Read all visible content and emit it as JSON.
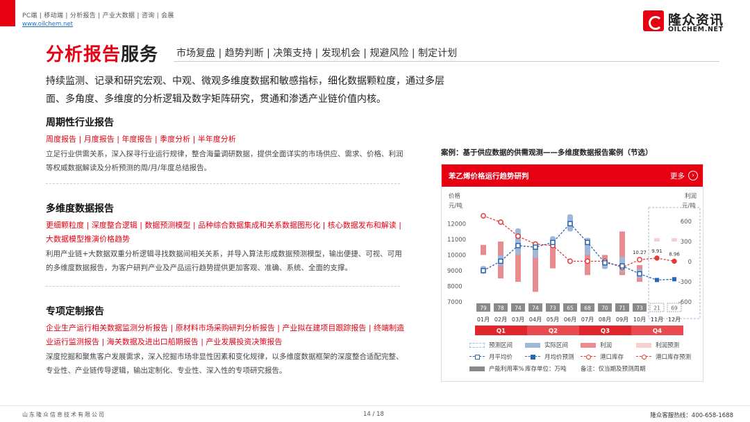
{
  "header": {
    "nav": "PC端 | 移动端 | 分析报告 | 产业大数据 | 咨询 | 会展",
    "url": "www.oilchem.net",
    "logo_cn": "隆众资讯",
    "logo_en": "OILCHEM.NET",
    "brand_color": "#e60012"
  },
  "title": {
    "red": "分析报告",
    "dark": "服务",
    "tags": "市场复盘 | 趋势判断 | 决策支持 | 发现机会 | 规避风险 | 制定计划"
  },
  "intro": "持续监测、记录和研究宏观、中观、微观多维度数据和敏感指标，细化数据颗粒度，通过多层面、多角度、多维度的分析逻辑及数字矩阵研究，贯通和渗透产业链价值内核。",
  "sections": [
    {
      "title": "周期性行业报告",
      "tags": "周度报告 | 月度报告 | 年度报告 | 季度分析 | 半年度分析",
      "desc": "立足行业供需关系，深入探寻行业运行规律，整合海量调研数据，提供全面详实的市场供应、需求、价格、利润等权威数据解读及分析预测的周/月/年度总结报告。"
    },
    {
      "title": "多维度数据报告",
      "tags": "更细颗粒度 | 深度整合逻辑 | 数据预测模型 | 品种综合数据集成和关系数据图形化 | 核心数据发布和解读 | 大数据模型推演价格趋势",
      "desc": "利用产业链+大数据双重分析逻辑寻找数据间相关关系，并导入算法形成数据预测模型，输出便捷、可视、可用的多维度数据报告，为客户研判产业及产品运行趋势提供更加客观、准确、系统、全面的支撑。"
    },
    {
      "title": "专项定制报告",
      "tags": "企业生产运行相关数据监测分析报告 | 原材料市场采购研判分析报告 | 产业拟在建项目跟踪报告 | 终端制造业运行监测报告 | 海关数据及进出口船期报告 | 产业发展投资决策报告",
      "desc": "深度挖掘和聚焦客户发展需求，深入挖掘市场非显性因素和变化规律，以多维度数据框架的深度整合适配完整、专业性、产业链传导逻辑，输出定制化、专业性、深入性的专项研究报告。"
    }
  ],
  "case": {
    "caption": "案例：基于供应数据的供需观测——多维度数据报告案例（节选）",
    "panel_title": "苯乙烯价格运行趋势研判",
    "more": "更多",
    "more_icon": "chevron-right-icon"
  },
  "chart_data": {
    "type": "combo",
    "left_axis_label": [
      "价格",
      "元/吨"
    ],
    "right_axis_label": [
      "利润",
      "元/吨"
    ],
    "left_ticks": [
      12000,
      11000,
      10000,
      9000,
      8000,
      7000
    ],
    "right_ticks": [
      600,
      300,
      0,
      -300,
      -600
    ],
    "ylim_left": [
      7000,
      12500
    ],
    "ylim_right": [
      -600,
      600
    ],
    "categories": [
      "01月",
      "02月",
      "03月",
      "04月",
      "05月",
      "06月",
      "07月",
      "08月",
      "09月",
      "10月",
      "11月",
      "12月"
    ],
    "quarters": [
      "Q1",
      "Q2",
      "Q3",
      "Q4"
    ],
    "utilization": [
      "79",
      "78",
      "74",
      "74",
      "73",
      "65",
      "68",
      "70",
      "71",
      "73",
      "21",
      "69"
    ],
    "forecast_months": [
      10,
      11
    ],
    "series": [
      {
        "name": "月平均价",
        "values": [
          9000,
          9600,
          10600,
          10500,
          10800,
          12000,
          10800,
          9500,
          9300,
          8800,
          null,
          null
        ]
      },
      {
        "name": "月均价预测",
        "values": [
          null,
          null,
          null,
          null,
          null,
          null,
          null,
          null,
          null,
          8800,
          8400,
          8450
        ]
      },
      {
        "name": "实际区间",
        "ranges": [
          [
            8800,
            9300
          ],
          [
            9300,
            10000
          ],
          [
            10000,
            11700
          ],
          [
            9800,
            10800
          ],
          [
            10400,
            11200
          ],
          [
            11500,
            12600
          ],
          [
            10000,
            11100
          ],
          [
            9100,
            9800
          ],
          [
            8900,
            9900
          ],
          [
            8500,
            9100
          ],
          null,
          null
        ]
      },
      {
        "name": "港口库存",
        "values": [
          12500,
          12100,
          11200,
          10700,
          10600,
          9600,
          9600,
          9600,
          9200,
          9700,
          null,
          null
        ]
      },
      {
        "name": "港口库存预测",
        "values": [
          null,
          null,
          null,
          null,
          null,
          null,
          null,
          null,
          null,
          9700,
          9800,
          9600
        ]
      },
      {
        "name": "利润",
        "ranges": [
          [
            100,
            250
          ],
          [
            -250,
            300
          ],
          [
            -300,
            150
          ],
          [
            -450,
            150
          ],
          [
            -100,
            250
          ],
          [
            null,
            null
          ],
          [
            -200,
            350
          ],
          [
            -100,
            100
          ],
          [
            -200,
            450
          ],
          [
            -300,
            -50
          ],
          null,
          null
        ]
      },
      {
        "name": "利润预测",
        "ranges": [
          null,
          null,
          null,
          null,
          null,
          null,
          null,
          null,
          null,
          null,
          [
            300,
            350
          ],
          [
            300,
            350
          ]
        ]
      }
    ],
    "labels": [
      "10.27",
      "9.91",
      "8.96"
    ],
    "legend": {
      "forecast_zone": "预测区间",
      "actual_range": "实际区间",
      "profit": "利润",
      "profit_forecast": "利润预测",
      "avg_price": "月平均价",
      "avg_price_forecast": "月均价预测",
      "port_inventory": "港口库存",
      "port_inventory_forecast": "港口库存预测",
      "utilization": "产能利用率%",
      "inventory_unit": "库存单位：万吨",
      "note": "备注：仅当期及预测周期"
    }
  },
  "footer": {
    "company": "山东隆众信息技术有限公司",
    "page": "14 / 18",
    "hotline": "隆众客服热线：400-658-1688"
  }
}
